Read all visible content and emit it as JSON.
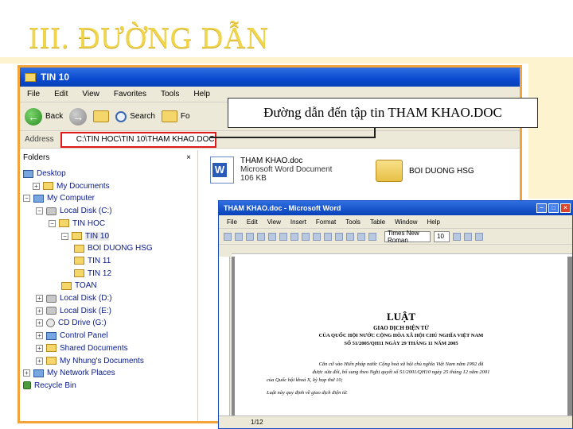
{
  "slide": {
    "title": "III. ĐƯỜNG DẪN"
  },
  "explorer": {
    "title": "TIN 10",
    "menu": [
      "File",
      "Edit",
      "View",
      "Favorites",
      "Tools",
      "Help"
    ],
    "toolbar": {
      "back": "Back",
      "search": "Search",
      "folders": "Fo"
    },
    "address_label": "Address",
    "address_value": "C:\\TIN HOC\\TIN 10\\THAM KHAO.DOC",
    "folders_label": "Folders",
    "close_glyph": "×",
    "tree": [
      {
        "label": "Desktop",
        "icon": "desktop-icon",
        "expander": ""
      },
      {
        "label": "My Documents",
        "icon": "folder-icon",
        "expander": "+"
      },
      {
        "label": "My Computer",
        "icon": "computer-icon",
        "expander": "−"
      },
      {
        "label": "Local Disk (C:)",
        "icon": "drive-icon",
        "expander": "−"
      },
      {
        "label": "TIN HOC",
        "icon": "folder-icon",
        "expander": "−"
      },
      {
        "label": "TIN 10",
        "icon": "folder-icon",
        "expander": "−"
      },
      {
        "label": "BOI DUONG HSG",
        "icon": "folder-icon",
        "expander": ""
      },
      {
        "label": "TIN 11",
        "icon": "folder-icon",
        "expander": ""
      },
      {
        "label": "TIN 12",
        "icon": "folder-icon",
        "expander": ""
      },
      {
        "label": "TOAN",
        "icon": "folder-icon",
        "expander": ""
      },
      {
        "label": "Local Disk (D:)",
        "icon": "drive-icon",
        "expander": "+"
      },
      {
        "label": "Local Disk (E:)",
        "icon": "drive-icon",
        "expander": "+"
      },
      {
        "label": "CD Drive (G:)",
        "icon": "cd-icon",
        "expander": "+"
      },
      {
        "label": "Control Panel",
        "icon": "control-panel-icon",
        "expander": "+"
      },
      {
        "label": "Shared Documents",
        "icon": "folder-icon",
        "expander": "+"
      },
      {
        "label": "My Nhung's Documents",
        "icon": "folder-icon",
        "expander": "+"
      },
      {
        "label": "My Network Places",
        "icon": "network-icon",
        "expander": "+"
      },
      {
        "label": "Recycle Bin",
        "icon": "recycle-bin-icon",
        "expander": ""
      }
    ],
    "files": [
      {
        "name": "THAM KHAO.doc",
        "type": "Microsoft Word Document",
        "size": "106 KB"
      },
      {
        "name": "BOI DUONG HSG"
      }
    ]
  },
  "callout": {
    "text": "Đường dẫn đến tập tin THAM KHAO.DOC"
  },
  "word": {
    "title": "THAM KHAO.doc - Microsoft Word",
    "menu": [
      "File",
      "Edit",
      "View",
      "Insert",
      "Format",
      "Tools",
      "Table",
      "Window",
      "Help"
    ],
    "font_name": "Times New Roman",
    "font_size": "10",
    "doc_heading": "LUẬT",
    "doc_subheading": "GIAO DỊCH ĐIỆN TỬ",
    "doc_line1": "CỦA QUỐC HỘI NƯỚC CỘNG HÒA XÃ HỘI CHỦ NGHĨA VIỆT NAM",
    "doc_line2": "SỐ 51/2005/QH11 NGÀY 29 THÁNG 11 NĂM 2005",
    "doc_para1": "Căn cứ vào Hiến pháp nước Cộng hoà xã hội chủ nghĩa Việt Nam năm 1992 đã",
    "doc_para2": "được sửa đổi, bổ sung theo Nghị quyết số 51/2001/QH10 ngày 25 tháng 12 năm 2001",
    "doc_para3": "của Quốc hội khoá X, kỳ họp thứ 10;",
    "doc_para4": "Luật này quy định về giao dịch điện tử.",
    "status": "1/12"
  }
}
